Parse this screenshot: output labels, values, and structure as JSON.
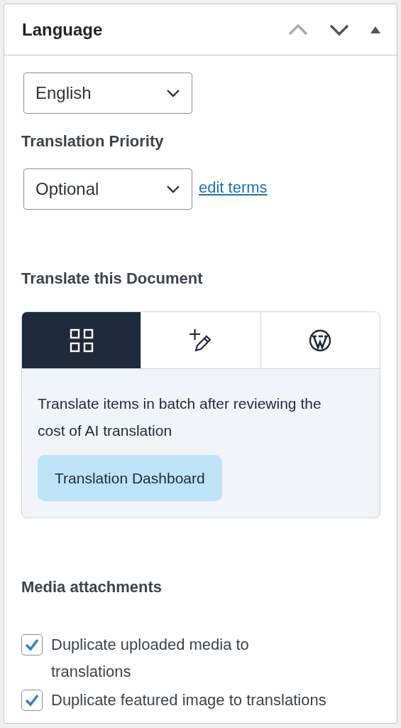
{
  "panel": {
    "title": "Language",
    "controls": [
      {
        "kind": "up",
        "disabled": true
      },
      {
        "kind": "down",
        "disabled": false
      },
      {
        "kind": "collapse",
        "disabled": false
      }
    ]
  },
  "language_select": {
    "value": "English"
  },
  "priority": {
    "label": "Translation Priority",
    "select": {
      "value": "Optional"
    },
    "link": "edit terms"
  },
  "translate": {
    "heading": "Translate this Document",
    "tabs": [
      {
        "kind": "grid",
        "selected": true
      },
      {
        "kind": "pencil",
        "selected": false
      },
      {
        "kind": "wordpress",
        "selected": false
      }
    ],
    "description": "Translate items in batch after reviewing the cost of AI translation",
    "button": "Translation Dashboard"
  },
  "media": {
    "heading": "Media attachments",
    "options": [
      {
        "label": "Duplicate uploaded media to translations",
        "checked": true
      },
      {
        "label": "Duplicate featured image to translations",
        "checked": true
      }
    ]
  }
}
